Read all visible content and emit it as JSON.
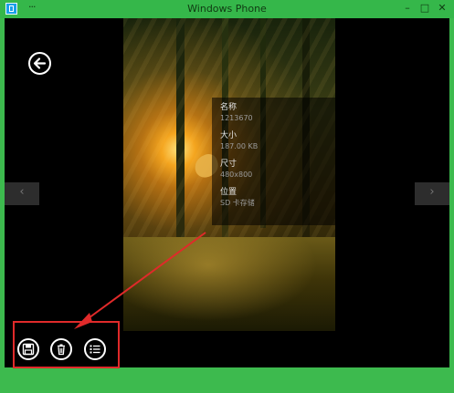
{
  "window": {
    "title": "Windows Phone",
    "menu_glyph": "···",
    "controls": {
      "minimize": "–",
      "maximize": "□",
      "close": "✕"
    }
  },
  "navigation": {
    "back_icon": "back-arrow-icon",
    "prev_arrow": "‹",
    "next_arrow": "›"
  },
  "details": [
    {
      "label": "名称",
      "value": "1213670"
    },
    {
      "label": "大小",
      "value": "187.00 KB"
    },
    {
      "label": "尺寸",
      "value": "480x800"
    },
    {
      "label": "位置",
      "value": "SD 卡存储"
    }
  ],
  "app_bar": {
    "buttons": [
      {
        "icon": "save-icon"
      },
      {
        "icon": "delete-icon"
      },
      {
        "icon": "details-list-icon"
      }
    ]
  },
  "colors": {
    "titlebar": "#35b74a",
    "highlight": "#e02a2a",
    "screen": "#000000"
  }
}
